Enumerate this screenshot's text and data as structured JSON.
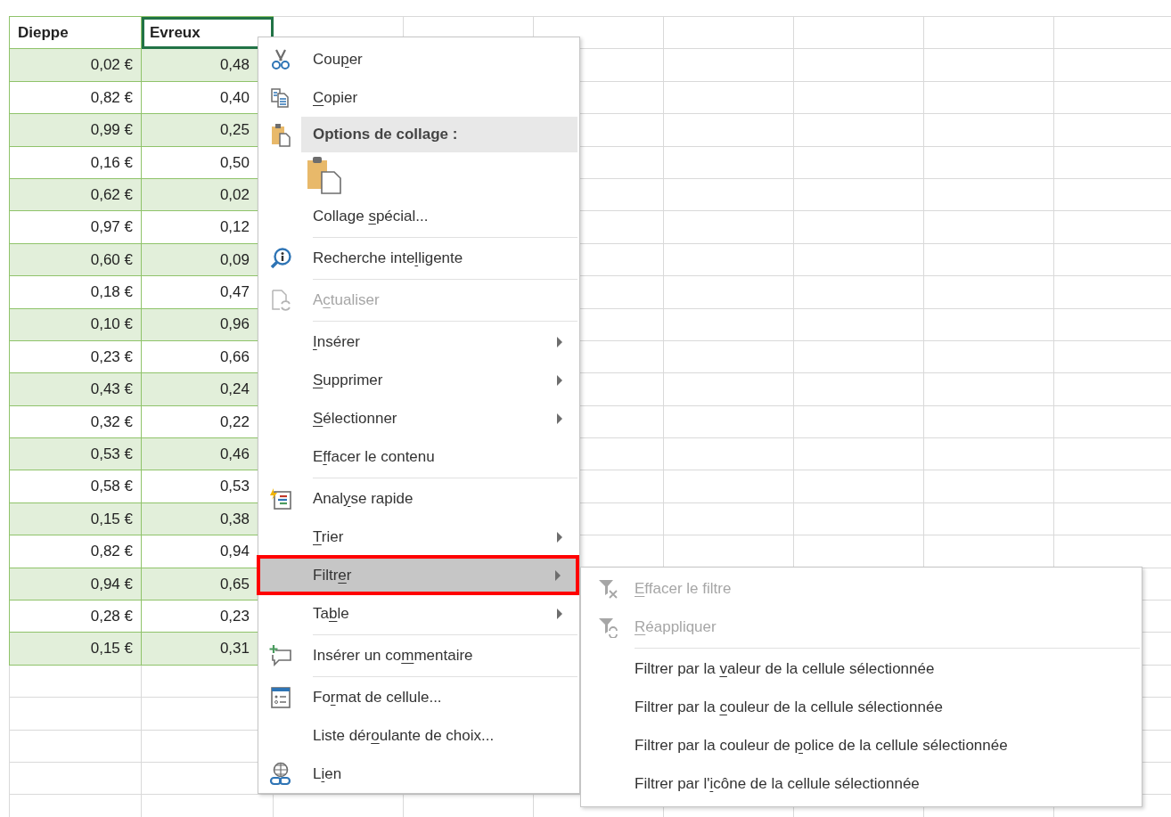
{
  "sheet": {
    "columns": [
      {
        "header": "Dieppe",
        "selected": false
      },
      {
        "header": "Evreux",
        "selected": true
      }
    ],
    "rows": [
      [
        "0,02 €",
        "0,48"
      ],
      [
        "0,82 €",
        "0,40"
      ],
      [
        "0,99 €",
        "0,25"
      ],
      [
        "0,16 €",
        "0,50"
      ],
      [
        "0,62 €",
        "0,02"
      ],
      [
        "0,97 €",
        "0,12"
      ],
      [
        "0,60 €",
        "0,09"
      ],
      [
        "0,18 €",
        "0,47"
      ],
      [
        "0,10 €",
        "0,96"
      ],
      [
        "0,23 €",
        "0,66"
      ],
      [
        "0,43 €",
        "0,24"
      ],
      [
        "0,32 €",
        "0,22"
      ],
      [
        "0,53 €",
        "0,46"
      ],
      [
        "0,58 €",
        "0,53"
      ],
      [
        "0,15 €",
        "0,38"
      ],
      [
        "0,82 €",
        "0,94"
      ],
      [
        "0,94 €",
        "0,65"
      ],
      [
        "0,28 €",
        "0,23"
      ],
      [
        "0,15 €",
        "0,31"
      ]
    ]
  },
  "menu": {
    "items": [
      {
        "kind": "item",
        "label": {
          "pre": "Cou",
          "key": "p",
          "post": "er"
        },
        "disabled": false,
        "submenu": false,
        "selected": false,
        "outlined": false
      },
      {
        "kind": "item",
        "label": {
          "key": "C",
          "post": "opier"
        },
        "disabled": false,
        "submenu": false,
        "selected": false,
        "outlined": false
      },
      {
        "kind": "header",
        "label": {
          "pre": "Options de collage :"
        }
      },
      {
        "kind": "paste_option"
      },
      {
        "kind": "item",
        "label": {
          "pre": "Collage ",
          "key": "s",
          "post": "pécial..."
        },
        "disabled": false,
        "submenu": false,
        "selected": false,
        "outlined": false
      },
      {
        "kind": "separator"
      },
      {
        "kind": "item",
        "label": {
          "pre": "Recherche inte",
          "key": "l",
          "post": "ligente"
        },
        "disabled": false,
        "submenu": false,
        "selected": false,
        "outlined": false
      },
      {
        "kind": "separator"
      },
      {
        "kind": "item",
        "label": {
          "pre": "A",
          "key": "c",
          "post": "tualiser"
        },
        "disabled": true,
        "submenu": false,
        "selected": false,
        "outlined": false
      },
      {
        "kind": "separator"
      },
      {
        "kind": "item",
        "label": {
          "key": "I",
          "post": "nsérer"
        },
        "disabled": false,
        "submenu": true,
        "selected": false,
        "outlined": false
      },
      {
        "kind": "item",
        "label": {
          "key": "S",
          "post": "upprimer"
        },
        "disabled": false,
        "submenu": true,
        "selected": false,
        "outlined": false
      },
      {
        "kind": "item",
        "label": {
          "key": "S",
          "post": "électionner"
        },
        "disabled": false,
        "submenu": true,
        "selected": false,
        "outlined": false
      },
      {
        "kind": "item",
        "label": {
          "pre": "E",
          "key": "f",
          "post": "facer le contenu"
        },
        "disabled": false,
        "submenu": false,
        "selected": false,
        "outlined": false
      },
      {
        "kind": "separator"
      },
      {
        "kind": "item",
        "label": {
          "pre": "Anal",
          "key": "y",
          "post": "se rapide"
        },
        "disabled": false,
        "submenu": false,
        "selected": false,
        "outlined": false
      },
      {
        "kind": "item",
        "label": {
          "key": "T",
          "post": "rier"
        },
        "disabled": false,
        "submenu": true,
        "selected": false,
        "outlined": false
      },
      {
        "kind": "item",
        "label": {
          "pre": "Filtr",
          "key": "e",
          "post": "r"
        },
        "disabled": false,
        "submenu": true,
        "selected": true,
        "outlined": true,
        "children": [
          {
            "kind": "item",
            "label": {
              "key": "E",
              "post": "ffacer le filtre"
            },
            "disabled": true
          },
          {
            "kind": "item",
            "label": {
              "key": "R",
              "post": "éappliquer"
            },
            "disabled": true
          },
          {
            "kind": "separator"
          },
          {
            "kind": "item",
            "label": {
              "pre": "Filtrer par la ",
              "key": "v",
              "post": "aleur de la cellule sélectionnée"
            },
            "disabled": false
          },
          {
            "kind": "item",
            "label": {
              "pre": "Filtrer par la ",
              "key": "c",
              "post": "ouleur de la cellule sélectionnée"
            },
            "disabled": false
          },
          {
            "kind": "item",
            "label": {
              "pre": "Filtrer par la couleur de ",
              "key": "p",
              "post": "olice de la cellule sélectionnée"
            },
            "disabled": false
          },
          {
            "kind": "item",
            "label": {
              "pre": "Filtrer par l'",
              "key": "i",
              "post": "cône de la cellule sélectionnée"
            },
            "disabled": false
          }
        ]
      },
      {
        "kind": "item",
        "label": {
          "pre": "Ta",
          "key": "b",
          "post": "le"
        },
        "disabled": false,
        "submenu": true,
        "selected": false,
        "outlined": false
      },
      {
        "kind": "separator"
      },
      {
        "kind": "item",
        "label": {
          "pre": "Insérer un co",
          "key": "m",
          "post": "mentaire"
        },
        "disabled": false,
        "submenu": false,
        "selected": false,
        "outlined": false
      },
      {
        "kind": "separator"
      },
      {
        "kind": "item",
        "label": {
          "pre": "Fo",
          "key": "r",
          "post": "mat de cellule..."
        },
        "disabled": false,
        "submenu": false,
        "selected": false,
        "outlined": false
      },
      {
        "kind": "item",
        "label": {
          "pre": "Liste dér",
          "key": "o",
          "post": "ulante de choix..."
        },
        "disabled": false,
        "submenu": false,
        "selected": false,
        "outlined": false
      },
      {
        "kind": "item",
        "label": {
          "pre": "L",
          "key": "i",
          "post": "en"
        },
        "disabled": false,
        "submenu": false,
        "selected": false,
        "outlined": false
      }
    ]
  }
}
